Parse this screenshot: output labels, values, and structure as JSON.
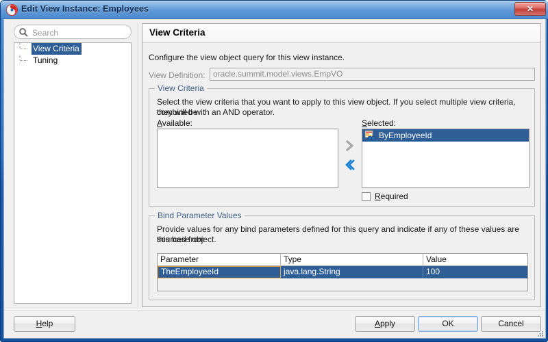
{
  "window": {
    "title": "Edit View Instance: Employees",
    "icon": "app-swirl-icon",
    "close_label": "✕"
  },
  "sidebar": {
    "search": {
      "placeholder": "Search",
      "value": "",
      "icon": "search-icon"
    },
    "tree_items": [
      {
        "label": "View Criteria",
        "selected": true
      },
      {
        "label": "Tuning",
        "selected": false
      }
    ]
  },
  "main": {
    "page_title": "View Criteria",
    "intro": "Configure the view object query for this view instance.",
    "view_definition": {
      "label": "View Definition:",
      "value": "oracle.summit.model.views.EmpVO",
      "disabled": true
    },
    "view_criteria_group": {
      "title": "View Criteria",
      "description_line1": "Select the view criteria that you want to apply to this view object. If you select multiple view criteria, they will be",
      "description_line2": "combined with an AND operator.",
      "available_label_pre": "A",
      "available_label_post": "vailable:",
      "selected_label_pre": "S",
      "selected_label_post": "elected:",
      "available_items": [],
      "selected_items": [
        {
          "label": "ByEmployeeId",
          "icon": "view-criteria-icon",
          "selected": true
        }
      ],
      "move_right_icon": "chevron-right-icon",
      "move_left_icon": "chevron-left-icon",
      "required_checkbox": {
        "label_pre": "R",
        "label_post": "equired",
        "checked": false
      }
    },
    "bind_parameters_group": {
      "title": "Bind Parameter Values",
      "description_line1": "Provide values for any bind parameters defined for this query and indicate if any of these values are sourced from",
      "description_line2": "this base object.",
      "columns": [
        "Parameter",
        "Type",
        "Value"
      ],
      "rows": [
        {
          "parameter": "TheEmployeeId",
          "type": "java.lang.String",
          "value": "100",
          "selected": true
        }
      ]
    }
  },
  "footer": {
    "help_pre": "H",
    "help_post": "elp",
    "apply_pre": "A",
    "apply_post": "pply",
    "ok": "OK",
    "cancel": "Cancel"
  },
  "colors": {
    "selection_blue": "#2f5d96",
    "group_title_blue": "#3f5f86",
    "focus_orange": "#e8a33d",
    "titlebar_blue": "#5f98d6"
  }
}
